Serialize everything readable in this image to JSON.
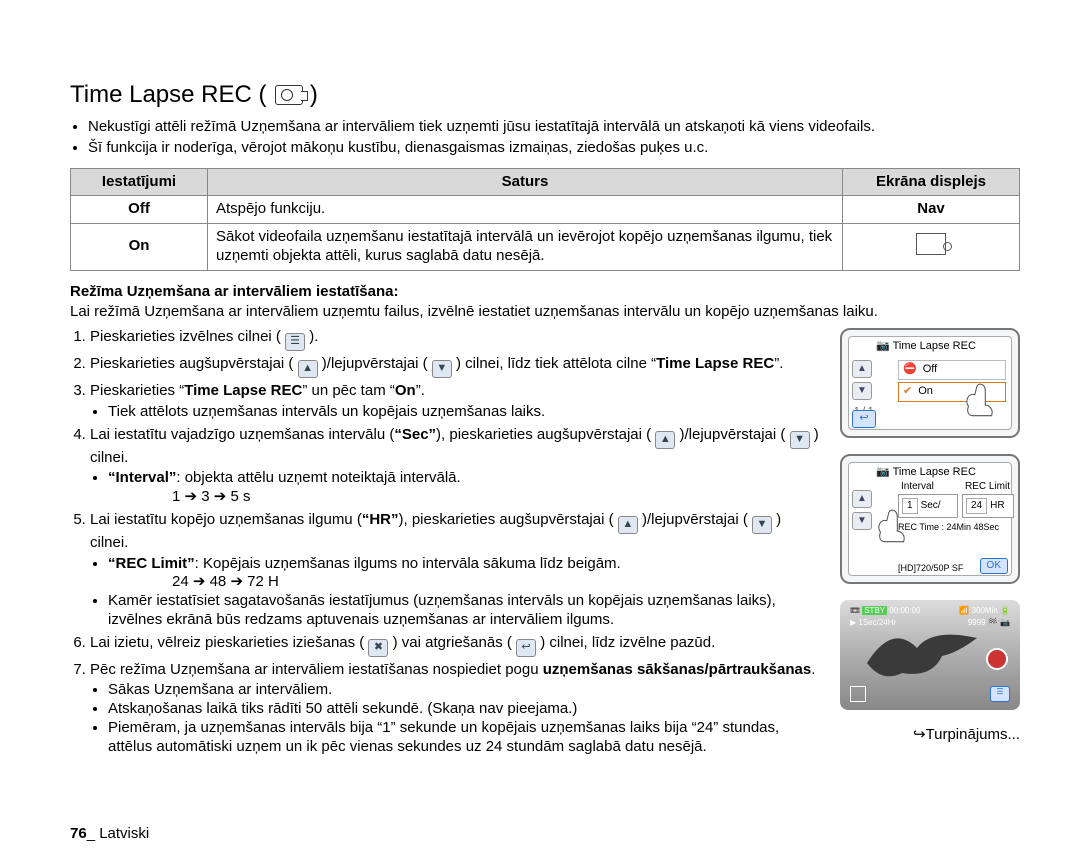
{
  "heading": "Time Lapse REC (",
  "heading_end": ")",
  "intro": [
    "Nekustīgi attēli režīmā Uzņemšana ar intervāliem tiek uzņemti jūsu iestatītajā intervālā un atskaņoti kā viens videofails.",
    "Šī funkcija ir noderīga, vērojot mākoņu kustību, dienasgaismas izmaiņas, ziedošas puķes u.c."
  ],
  "table": {
    "h1": "Iestatījumi",
    "h2": "Saturs",
    "h3": "Ekrāna displejs",
    "r1c1": "Off",
    "r1c2": "Atspējo funkciju.",
    "r1c3": "Nav",
    "r2c1": "On",
    "r2c2": "Sākot videofaila uzņemšanu iestatītajā intervālā un ievērojot kopējo uzņemšanas ilgumu, tiek uzņemti objekta attēli, kurus saglabā datu nesējā."
  },
  "section_title": "Režīma Uzņemšana ar intervāliem iestatīšana:",
  "section_para": "Lai režīmā Uzņemšana ar intervāliem uzņemtu failus, izvēlnē iestatiet uzņemšanas intervālu un kopējo uzņemšanas laiku.",
  "steps": {
    "s1a": "Pieskarieties izvēlnes cilnei (",
    "s1b": ").",
    "s2a": "Pieskarieties augšupvērstajai (",
    "s2b": ")/lejupvērstajai (",
    "s2c": ") cilnei, līdz tiek attēlota cilne “",
    "s2d": "Time Lapse REC",
    "s2e": "”.",
    "s3a": "Pieskarieties “",
    "s3b": "Time Lapse REC",
    "s3c": "” un pēc tam “",
    "s3d": "On",
    "s3e": "”.",
    "s3bul": "Tiek attēlots uzņemšanas intervāls un kopējais uzņemšanas laiks.",
    "s4a": "Lai iestatītu vajadzīgo uzņemšanas intervālu (",
    "s4b": "“Sec”",
    "s4c": "), pieskarieties augšupvērstajai (",
    "s4d": ")/lejupvērstajai (",
    "s4e": ") cilnei.",
    "s4l1a": "“Interval”",
    "s4l1b": ": objekta attēlu uzņemt noteiktajā intervālā.",
    "s4l2": "1 ➔ 3 ➔ 5 s",
    "s5a": "Lai iestatītu kopējo uzņemšanas ilgumu (",
    "s5b": "“HR”",
    "s5c": "), pieskarieties augšupvērstajai (",
    "s5d": ")/lejupvērstajai (",
    "s5e": ") cilnei.",
    "s5l1a": "“REC Limit”",
    "s5l1b": ": Kopējais uzņemšanas ilgums no intervāla sākuma līdz beigām.",
    "s5l2": "24 ➔ 48 ➔ 72 H",
    "s5l3": "Kamēr iestatīsiet sagatavošanās iestatījumus (uzņemšanas intervāls un kopējais uzņemšanas laiks), izvēlnes ekrānā būs redzams aptuvenais uzņemšanas ar intervāliem ilgums.",
    "s6a": "Lai izietu, vēlreiz pieskarieties iziešanas (",
    "s6b": ") vai atgriešanās (",
    "s6c": ") cilnei, līdz izvēlne pazūd.",
    "s7a": "Pēc režīma Uzņemšana ar intervāliem iestatīšanas nospiediet pogu ",
    "s7b": "uzņemšanas sākšanas/pārtraukšanas",
    "s7c": ".",
    "s7l1": "Sākas Uzņemšana ar intervāliem.",
    "s7l2": "Atskaņošanas laikā tiks rādīti 50 attēli sekundē. (Skaņa nav pieejama.)",
    "s7l3": "Piemēram, ja uzņemšanas intervāls bija “1” sekunde un kopējais uzņemšanas laiks bija “24” stundas, attēlus automātiski uzņem un ik pēc vienas sekundes uz 24 stundām saglabā datu nesējā."
  },
  "icons": {
    "menu": "☰",
    "up": "▲",
    "down": "▼",
    "close": "✖",
    "back": "↩"
  },
  "shot1": {
    "title": "Time Lapse REC",
    "off": "Off",
    "on": "On",
    "page": "1 / 1"
  },
  "shot2": {
    "title": "Time Lapse REC",
    "interval": "Interval",
    "limit": "REC Limit",
    "ival": "1",
    "iunit": "Sec/",
    "lval": "24",
    "lunit": "HR",
    "rectime": "REC Time : 24Min 48Sec",
    "hd": "[HD]720/50P SF",
    "ok": "OK"
  },
  "shot3": {
    "stby": "STBY",
    "time": "00:00:00",
    "min": "300Min",
    "line2l": "1Sec/24Hr",
    "line2r": "9999"
  },
  "continued": "↪Turpinājums...",
  "footer_page": "76",
  "footer_sep": "_ ",
  "footer_lang": "Latviski"
}
